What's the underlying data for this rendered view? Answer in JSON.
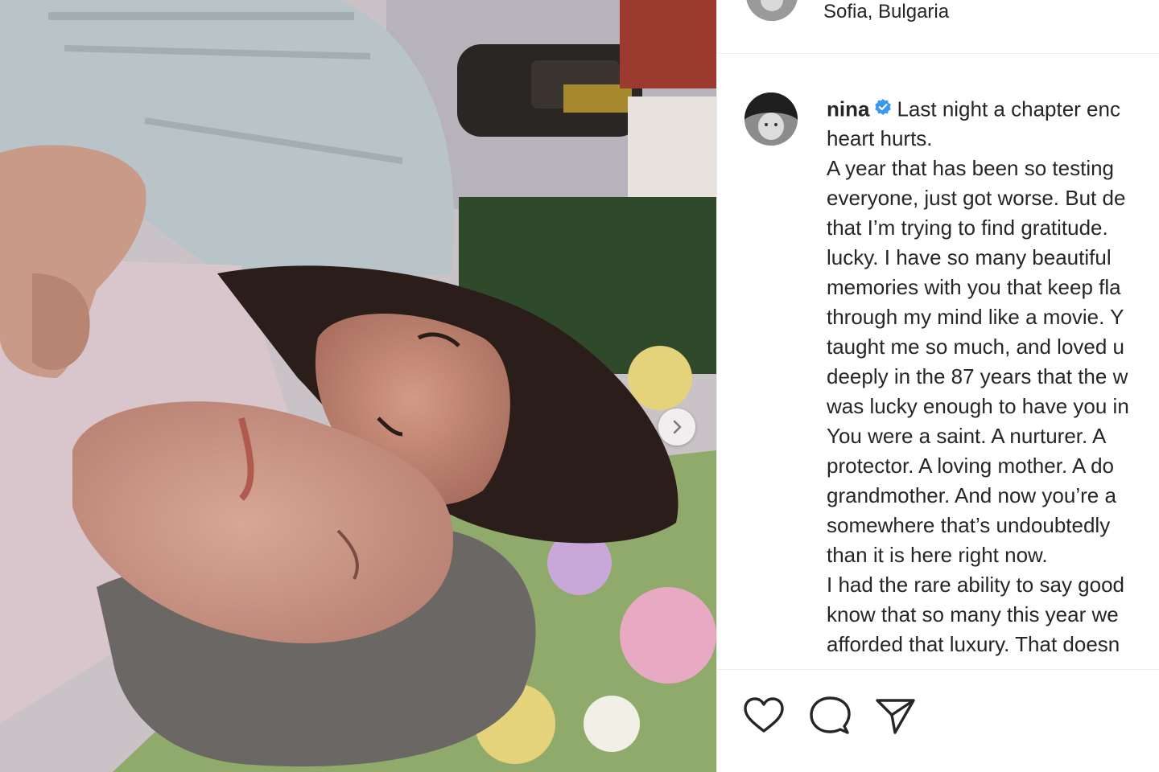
{
  "post": {
    "location": "Sofia, Bulgaria",
    "username": "nina",
    "verified": true,
    "caption_lines": [
      "Last night a chapter enc",
      "heart hurts.",
      "A year that has been so testing",
      "everyone, just got worse. But de",
      "that I’m trying to find gratitude.",
      "lucky. I have so many beautiful",
      "memories with you that keep fla",
      "through my mind like a movie. Y",
      "taught me so much, and loved u",
      "deeply in the 87 years that the w",
      "was lucky enough to have you in",
      "You were a saint. A nurturer. A",
      "protector. A loving mother. A do",
      "grandmother. And now you’re a",
      "somewhere that’s undoubtedly",
      "than it is here right now.",
      "I had the rare ability to say good",
      "know that so many this year we",
      "afforded that luxury. That doesn"
    ]
  },
  "icons": {
    "carousel_next": "chevron-right-icon",
    "like": "heart-icon",
    "comment": "comment-bubble-icon",
    "share": "paper-plane-icon",
    "verified": "verified-badge-icon"
  },
  "colors": {
    "verified_blue": "#3897f0",
    "text": "#262626"
  }
}
